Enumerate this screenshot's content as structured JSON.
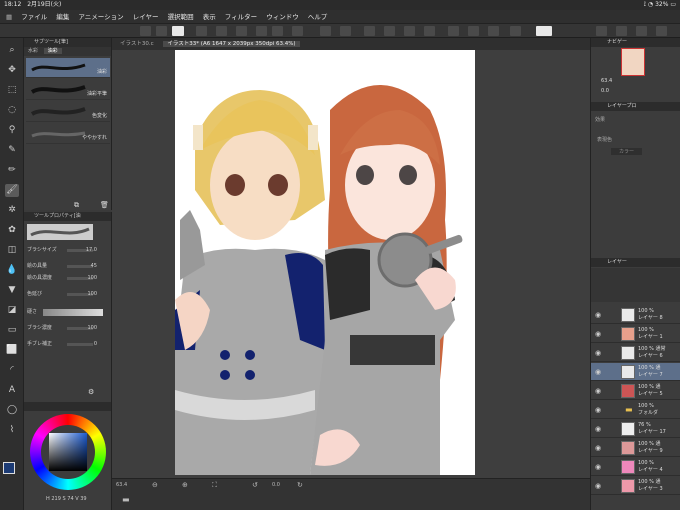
{
  "status": {
    "time": "18:12",
    "date": "2月19日(火)",
    "battery": "32%"
  },
  "menu": [
    "ファイル",
    "編集",
    "アニメーション",
    "レイヤー",
    "選択範囲",
    "表示",
    "フィルター",
    "ウィンドウ",
    "ヘルプ"
  ],
  "subtool": {
    "header": "サブツール[筆]",
    "tabs": [
      "水彩",
      "油彩"
    ],
    "brushes": [
      "油彩",
      "油彩平筆",
      "色変化",
      "ややかすれ"
    ]
  },
  "toolprop": {
    "header": "ツールプロパティ[油",
    "rows": [
      {
        "label": "ブラシサイズ",
        "value": "17.0"
      },
      {
        "label": "絵の具量",
        "value": "45"
      },
      {
        "label": "絵の具濃度",
        "value": "100"
      },
      {
        "label": "色延び",
        "value": "100"
      },
      {
        "label": "硬さ",
        "value": ""
      },
      {
        "label": "ブラシ濃度",
        "value": "100"
      },
      {
        "label": "手ブレ補正",
        "value": "0"
      }
    ]
  },
  "color": {
    "main": "#1c3b75",
    "sub": "#ffffff",
    "hsv": [
      "219",
      "74",
      "39"
    ]
  },
  "document": {
    "tabs": [
      "イラスト30.c",
      "イラスト33* (A6 1647 x 2039px 350dpi 63.4%)"
    ]
  },
  "bottom": {
    "zoom": "63.4",
    "coords": "0.0"
  },
  "navigator": {
    "header": "ナビゲー",
    "zoom": "63.4",
    "angle": "0.0"
  },
  "layerprop": {
    "header": "レイヤープロ",
    "label1": "効果",
    "label2": "表現色",
    "mode": "カラー"
  },
  "layers": {
    "header": "レイヤー",
    "items": [
      {
        "pct": "100 %",
        "name": "レイヤー 8"
      },
      {
        "pct": "100 %",
        "name": "レイヤー 1"
      },
      {
        "pct": "100 % 通常",
        "name": "レイヤー 6"
      },
      {
        "pct": "100 % 通",
        "name": "レイヤー 7"
      },
      {
        "pct": "100 % 通",
        "name": "レイヤー 5"
      },
      {
        "pct": "100 %",
        "name": "フォルダ"
      },
      {
        "pct": "76 %",
        "name": "レイヤー 17"
      },
      {
        "pct": "100 % 通",
        "name": "レイヤー 9"
      },
      {
        "pct": "100 %",
        "name": "レイヤー 4"
      },
      {
        "pct": "100 % 通",
        "name": "レイヤー 3"
      }
    ]
  }
}
